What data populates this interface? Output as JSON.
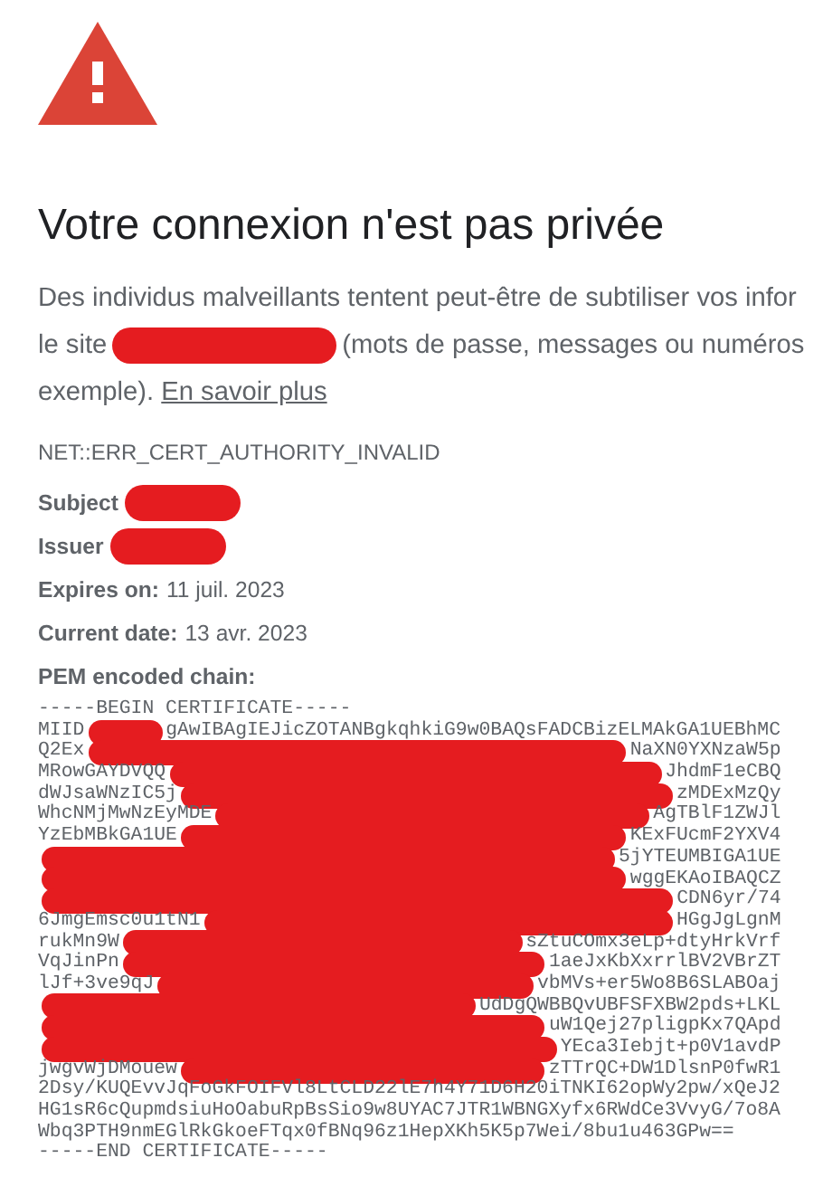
{
  "heading": "Votre connexion n'est pas privée",
  "intro": {
    "line_1": "Des individus malveillants tentent peut-être de subtiliser vos infor",
    "line_2_start": "le site",
    "line_2_end": "(mots de passe, messages ou numéros",
    "line_3": "exemple).",
    "link": "En savoir plus"
  },
  "error_code": "NET::ERR_CERT_AUTHORITY_INVALID",
  "details": [
    {
      "label": "Subject",
      "kind": "redacted"
    },
    {
      "label": "Issuer",
      "kind": "redacted"
    },
    {
      "label": "Expires on:",
      "kind": "text",
      "value": "11 juil. 2023"
    },
    {
      "label": "Current date:",
      "kind": "text",
      "value": "13 avr. 2023"
    },
    {
      "label": "PEM encoded chain:",
      "kind": "heading"
    }
  ],
  "pem_lines": [
    {
      "left": "-----BEGIN CERTIFICATE-----"
    },
    {
      "left": "MIID",
      "right": "gAwIBAgIEJicZOTANBgkqhkiG9w0BAQsFADCBizELMAkGA1UEBhMC"
    },
    {
      "left": "Q2Ex",
      "right": "NaXN0YXNzaW5p"
    },
    {
      "left": "MRowGAYDVQQ",
      "right": "JhdmF1eCBQ"
    },
    {
      "left": "dWJsaWNzIC5j",
      "right": "zMDExMzQy"
    },
    {
      "left": "WhcNMjMwNzEyMDE",
      "right": "AgTBlF1ZWJl"
    },
    {
      "left": "YzEbMBkGA1UE",
      "right": "KExFUcmF2YXV4"
    },
    {
      "right": "5jYTEUMBIGA1UE"
    },
    {
      "right": "wggEKAoIBAQCZ"
    },
    {
      "right": "CDN6yr/74"
    },
    {
      "left": "6JmgEmsc0u1tN1",
      "right": "HGgJgLgnM"
    },
    {
      "left": "rukMn9W",
      "right": "sZtuCOmx3eLp+dtyHrkVrf"
    },
    {
      "left": "VqJinPn",
      "right": "1aeJxKbXxrrlBV2VBrZT"
    },
    {
      "left": "lJf+3ve9qJ",
      "right": "vbMVs+er5Wo8B6SLABOaj"
    },
    {
      "right": "UdDgQWBBQvUBFSFXBW2pds+LKL"
    },
    {
      "right": "uW1Qej27pligpKx7QApd"
    },
    {
      "right": "YEca3Iebjt+p0V1avdP"
    },
    {
      "left": "jwgvWjDMouew",
      "right": "zTTrQC+DW1DlsnP0fwR1"
    },
    {
      "left": "2Dsy/KUQEvvJqFoGkFOIFVl8LtCLD22lE7h4Y71D6H20iTNKI62opWy2pw/xQeJ2"
    },
    {
      "left": "HG1sR6cQupmdsiuHoOabuRpBsSio9w8UYAC7JTR1WBNGXyfx6RWdCe3VvyG/7o8A"
    },
    {
      "left": "Wbq3PTH9nmEGlRkGkoeFTqx0fBNq96z1HepXKh5K5p7Wei/8bu1u463GPw=="
    },
    {
      "left": "-----END CERTIFICATE-----"
    }
  ]
}
